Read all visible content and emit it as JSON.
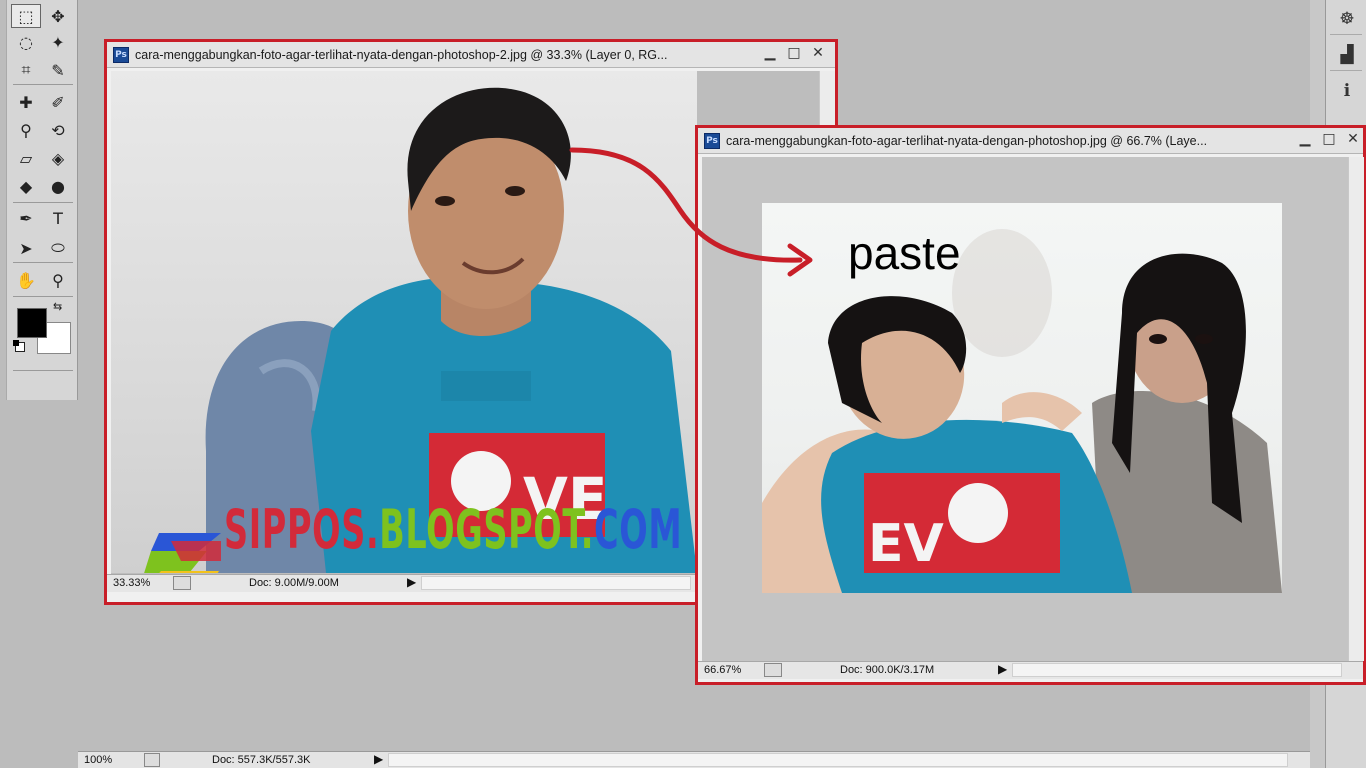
{
  "main_status": {
    "zoom": "100%",
    "doc": "Doc: 557.3K/557.3K"
  },
  "window1": {
    "title": "cara-menggabungkan-foto-agar-terlihat-nyata-dengan-photoshop-2.jpg @ 33.3% (Layer 0, RG...",
    "zoom": "33.33%",
    "doc": "Doc: 9.00M/9.00M"
  },
  "window2": {
    "title": "cara-menggabungkan-foto-agar-terlihat-nyata-dengan-photoshop.jpg @ 66.7% (Laye...",
    "zoom": "66.67%",
    "doc": "Doc: 900.0K/3.17M"
  },
  "annotation": {
    "label": "paste"
  },
  "watermark": {
    "part1": "SIPPOS.",
    "part2": "BLOGSPOT.",
    "part3": "COM"
  },
  "shirt_print": {
    "left": "VE",
    "right": "EV"
  },
  "colors": {
    "frame": "#c81e28",
    "arrow": "#c81e28",
    "shirt": "#1f8fb5",
    "print": "#d42a36"
  },
  "tools": [
    {
      "icon": "marquee-icon",
      "glyph": "⬚"
    },
    {
      "icon": "move-icon",
      "glyph": "✥"
    },
    {
      "icon": "lasso-icon",
      "glyph": "◌"
    },
    {
      "icon": "magic-wand-icon",
      "glyph": "✦"
    },
    {
      "icon": "crop-icon",
      "glyph": "⌗"
    },
    {
      "icon": "eyedropper-icon",
      "glyph": "✎"
    },
    {
      "icon": "healing-icon",
      "glyph": "✚"
    },
    {
      "icon": "brush-icon",
      "glyph": "✐"
    },
    {
      "icon": "stamp-icon",
      "glyph": "⚲"
    },
    {
      "icon": "history-brush-icon",
      "glyph": "⟲"
    },
    {
      "icon": "eraser-icon",
      "glyph": "▱"
    },
    {
      "icon": "paint-bucket-icon",
      "glyph": "◈"
    },
    {
      "icon": "blur-icon",
      "glyph": "◆"
    },
    {
      "icon": "dodge-icon",
      "glyph": "●"
    },
    {
      "icon": "pen-icon",
      "glyph": "✒"
    },
    {
      "icon": "type-icon",
      "glyph": "T"
    },
    {
      "icon": "path-select-icon",
      "glyph": "➤"
    },
    {
      "icon": "ellipse-icon",
      "glyph": "⬭"
    },
    {
      "icon": "hand-icon",
      "glyph": "✋"
    },
    {
      "icon": "zoom-icon",
      "glyph": "⚲"
    }
  ],
  "right_panel": [
    {
      "icon": "navigator-icon",
      "glyph": "☸"
    },
    {
      "icon": "histogram-icon",
      "glyph": "▟"
    },
    {
      "icon": "info-icon",
      "glyph": "ℹ"
    }
  ]
}
